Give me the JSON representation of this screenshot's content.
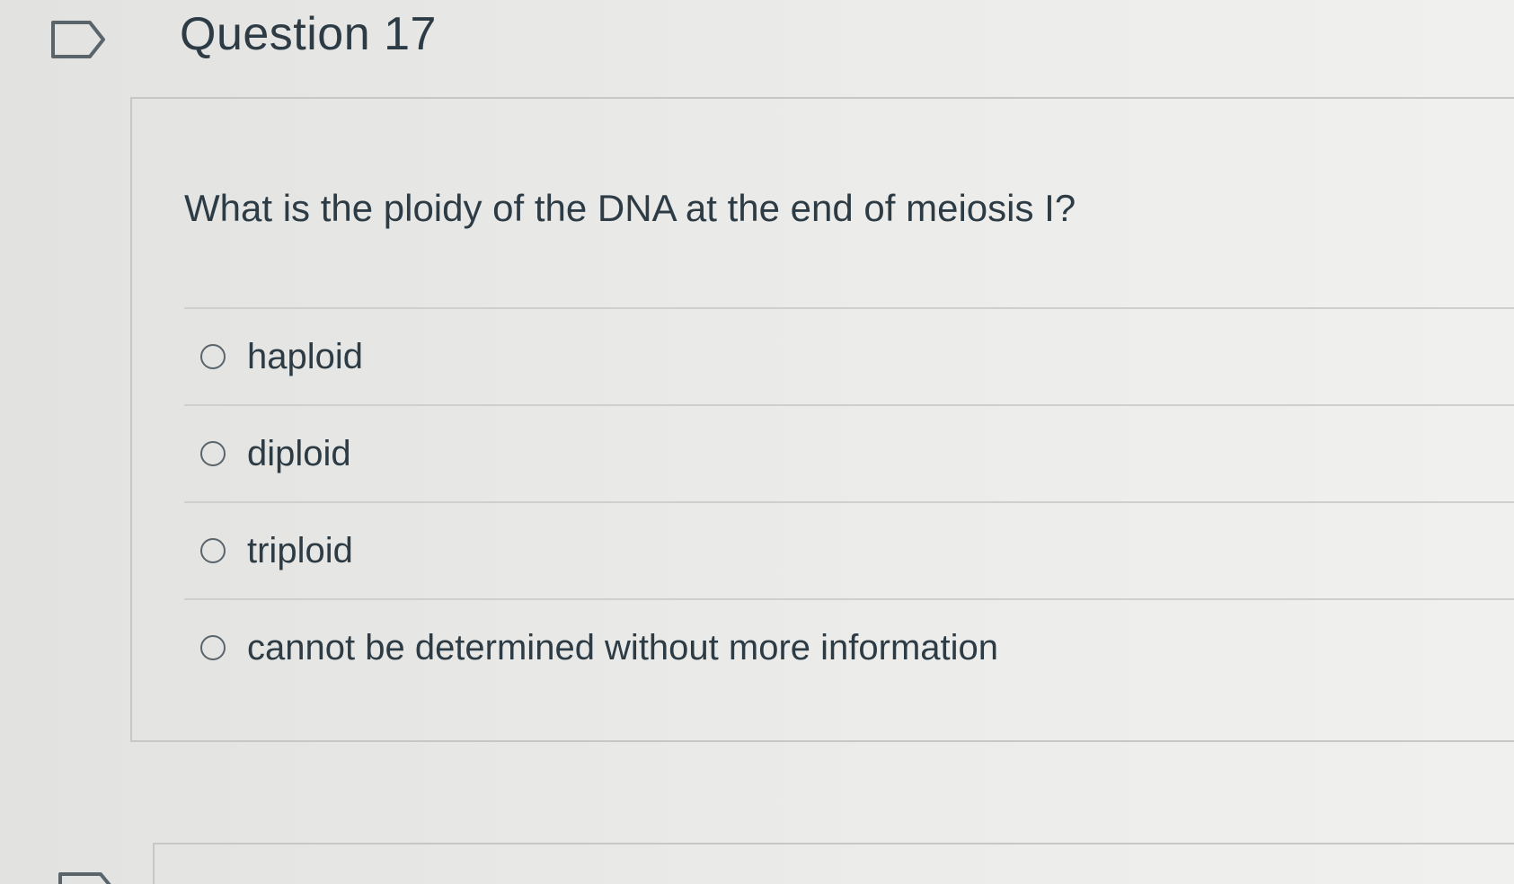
{
  "question": {
    "title": "Question 17",
    "text": "What is the ploidy of the DNA at the end of meiosis I?",
    "answers": [
      {
        "label": "haploid",
        "selected": false
      },
      {
        "label": "diploid",
        "selected": false
      },
      {
        "label": "triploid",
        "selected": false
      },
      {
        "label": "cannot be determined without more information",
        "selected": false
      }
    ]
  },
  "icons": {
    "flag": "flag-question-icon",
    "radio": "radio-button-icon"
  },
  "colors": {
    "text": "#2d3b45",
    "border": "#c7c7c5",
    "background": "#e8e8e6"
  }
}
